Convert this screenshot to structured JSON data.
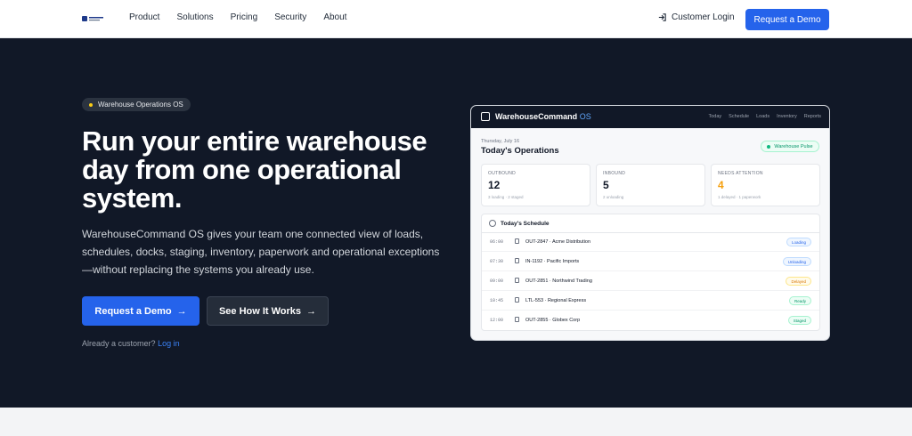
{
  "nav": {
    "links": [
      "Product",
      "Solutions",
      "Pricing",
      "Security",
      "About"
    ],
    "login_label": "Customer Login",
    "cta_label": "Request a Demo"
  },
  "hero": {
    "pill": "Warehouse Operations OS",
    "headline": "Run your entire warehouse day from one operational system.",
    "lead": "WarehouseCommand OS gives your team one connected view of loads, schedules, docks, staging, inventory, paperwork and operational exceptions—without replacing the systems you already use.",
    "primary_cta": "Request a Demo",
    "secondary_cta": "See How It Works",
    "already_text": "Already a customer?",
    "login_link": "Log in"
  },
  "dashboard": {
    "brand": "WarehouseCommand",
    "brand_suffix": "OS",
    "tabs": [
      "Today",
      "Schedule",
      "Loads",
      "Inventory",
      "Reports"
    ],
    "date": "Thursday, July 16",
    "title": "Today's Operations",
    "pulse": "Warehouse Pulse",
    "stats": [
      {
        "label": "OUTBOUND",
        "value": "12",
        "sub": "3 loading · 2 staged",
        "color": "#111827"
      },
      {
        "label": "INBOUND",
        "value": "5",
        "sub": "2 unloading",
        "color": "#111827"
      },
      {
        "label": "NEEDS ATTENTION",
        "value": "4",
        "sub": "1 delayed · 1 paperwork",
        "color": "#f59e0b"
      }
    ],
    "schedule_title": "Today's Schedule",
    "schedule": [
      {
        "time": "06:00",
        "text": "OUT-2847 · Acme Distribution",
        "status": "Loading",
        "fg": "#2563eb",
        "bg": "#eff6ff",
        "bd": "#bfdbfe"
      },
      {
        "time": "07:30",
        "text": "IN-1192 · Pacific Imports",
        "status": "Unloading",
        "fg": "#2563eb",
        "bg": "#eff6ff",
        "bd": "#bfdbfe"
      },
      {
        "time": "09:00",
        "text": "OUT-2851 · Northwind Trading",
        "status": "Delayed",
        "fg": "#d97706",
        "bg": "#fffbeb",
        "bd": "#fde68a"
      },
      {
        "time": "10:45",
        "text": "LTL-553 · Regional Express",
        "status": "Ready",
        "fg": "#059669",
        "bg": "#ecfdf5",
        "bd": "#a7f3d0"
      },
      {
        "time": "12:00",
        "text": "OUT-2855 · Globex Corp",
        "status": "Staged",
        "fg": "#059669",
        "bg": "#ecfdf5",
        "bd": "#a7f3d0"
      }
    ]
  },
  "colors": {
    "accent": "#2563eb",
    "hero_bg": "#111827"
  }
}
